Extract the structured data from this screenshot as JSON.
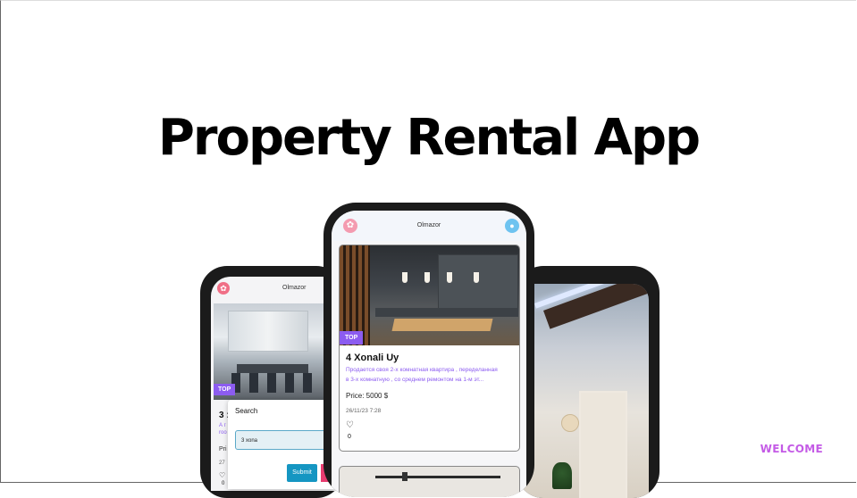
{
  "page": {
    "title": "Property Rental App",
    "tagline": "WELCOME"
  },
  "colors": {
    "accent_purple": "#8c5cf0",
    "welcome_pink": "#c45be6",
    "submit_blue": "#1596c2"
  },
  "left_phone": {
    "location": "Olmazor",
    "badge": "TOP",
    "card_title": "3 :",
    "desc_lines": [
      "А г",
      "roo"
    ],
    "price_prefix": "Pri",
    "date": "27",
    "likes": "0",
    "dialog": {
      "title": "Search",
      "input_value": "3 xona",
      "submit_label": "Submit"
    }
  },
  "center_phone": {
    "location": "Olmazor",
    "badge": "TOP",
    "listing": {
      "title": "4 Xonali Uy",
      "description_lines": [
        "Продается своя 2-х комнатная квартира , переделанная",
        "в 3-х комнатную , со среднем ремонтом на 1-м эт..."
      ],
      "price": "Price: 5000 $",
      "date": "26/11/23 7:28",
      "likes": "0"
    }
  },
  "icons": {
    "logo": "flower-logo-icon",
    "profile": "user-avatar-icon",
    "like": "heart-outline-icon"
  }
}
